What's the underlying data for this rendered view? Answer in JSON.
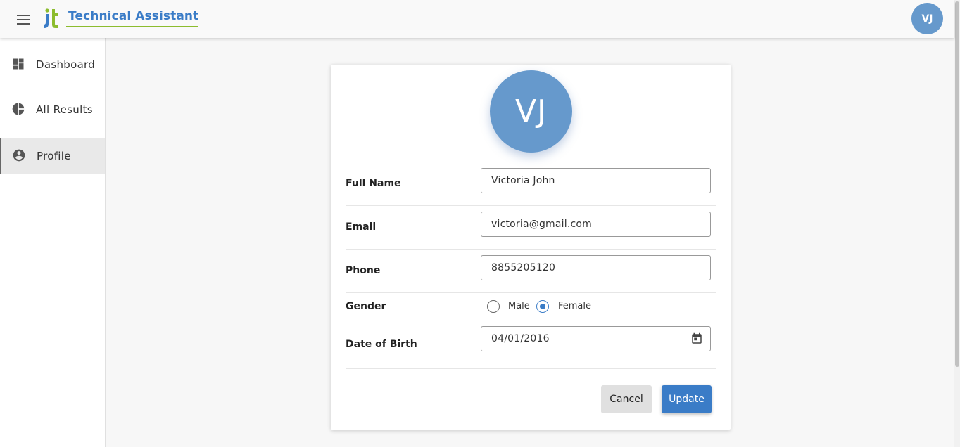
{
  "app": {
    "title": "Technical Assistant",
    "user_initials": "VJ"
  },
  "sidebar": {
    "items": [
      {
        "label": "Dashboard",
        "icon": "dashboard-icon"
      },
      {
        "label": "All Results",
        "icon": "pie-chart-icon"
      },
      {
        "label": "Profile",
        "icon": "account-circle-icon",
        "active": true
      }
    ]
  },
  "profile": {
    "initials": "VJ",
    "fields": {
      "full_name": {
        "label": "Full Name",
        "value": "Victoria John"
      },
      "email": {
        "label": "Email",
        "value": "victoria@gmail.com"
      },
      "phone": {
        "label": "Phone",
        "value": "8855205120"
      },
      "gender": {
        "label": "Gender",
        "options": [
          "Male",
          "Female"
        ],
        "selected": "Female"
      },
      "dob": {
        "label": "Date of Birth",
        "value": "04/01/2016"
      }
    },
    "buttons": {
      "cancel": "Cancel",
      "update": "Update"
    }
  },
  "colors": {
    "primary": "#3a7cc7",
    "avatar": "#6699cc",
    "logo_green": "#8cbc2e"
  }
}
